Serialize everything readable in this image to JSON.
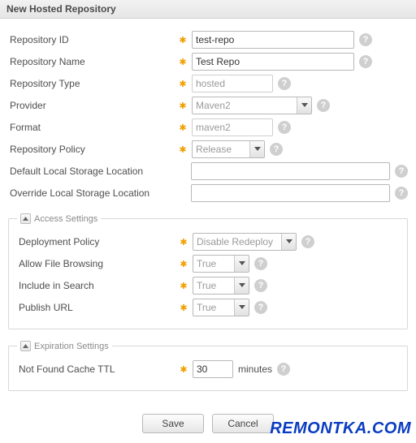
{
  "header": {
    "title": "New Hosted Repository"
  },
  "fields": {
    "repo_id": {
      "label": "Repository ID",
      "value": "test-repo",
      "required": true
    },
    "repo_name": {
      "label": "Repository Name",
      "value": "Test Repo",
      "required": true
    },
    "repo_type": {
      "label": "Repository Type",
      "value": "hosted",
      "required": true,
      "readonly": true
    },
    "provider": {
      "label": "Provider",
      "value": "Maven2",
      "required": true
    },
    "format": {
      "label": "Format",
      "value": "maven2",
      "required": true,
      "readonly": true
    },
    "repo_policy": {
      "label": "Repository Policy",
      "value": "Release",
      "required": true
    },
    "default_loc": {
      "label": "Default Local Storage Location",
      "value": "",
      "required": false
    },
    "override_loc": {
      "label": "Override Local Storage Location",
      "value": "",
      "required": false
    }
  },
  "access": {
    "legend": "Access Settings",
    "deployment_policy": {
      "label": "Deployment Policy",
      "value": "Disable Redeploy",
      "required": true
    },
    "allow_browsing": {
      "label": "Allow File Browsing",
      "value": "True",
      "required": true
    },
    "include_search": {
      "label": "Include in Search",
      "value": "True",
      "required": true
    },
    "publish_url": {
      "label": "Publish URL",
      "value": "True",
      "required": true
    }
  },
  "expiration": {
    "legend": "Expiration Settings",
    "nf_cache_ttl": {
      "label": "Not Found Cache TTL",
      "value": "30",
      "suffix": "minutes",
      "required": true
    }
  },
  "buttons": {
    "save": "Save",
    "cancel": "Cancel"
  },
  "icons": {
    "help_glyph": "?",
    "required_glyph": "✱"
  },
  "watermark": "REMONTKA.COM"
}
